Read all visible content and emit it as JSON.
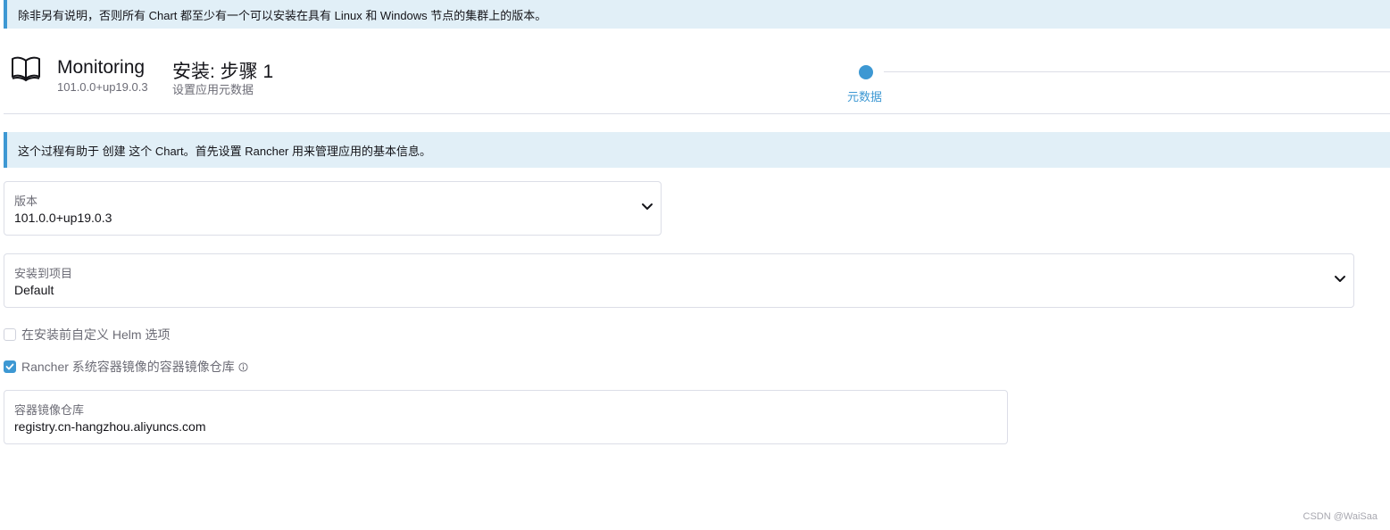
{
  "banners": {
    "top": "除非另有说明，否则所有 Chart 都至少有一个可以安装在具有 Linux 和 Windows 节点的集群上的版本。",
    "mid": "这个过程有助于 创建 这个 Chart。首先设置 Rancher 用来管理应用的基本信息。"
  },
  "header": {
    "app_name": "Monitoring",
    "app_version": "101.0.0+up19.0.3",
    "step_title": "安装: 步骤 1",
    "step_subtitle": "设置应用元数据",
    "step_label": "元数据"
  },
  "form": {
    "version": {
      "label": "版本",
      "value": "101.0.0+up19.0.3"
    },
    "project": {
      "label": "安装到项目",
      "value": "Default"
    },
    "customize_helm": {
      "label": "在安装前自定义 Helm 选项",
      "checked": false
    },
    "system_registry": {
      "label": "Rancher 系统容器镜像的容器镜像仓库",
      "checked": true
    },
    "registry": {
      "label": "容器镜像仓库",
      "value": "registry.cn-hangzhou.aliyuncs.com"
    }
  },
  "watermark": "CSDN @WaiSaa",
  "colors": {
    "accent": "#3d98d3",
    "banner_bg": "#e1eff7",
    "muted_text": "#6c6c76",
    "border": "#dcdee7"
  },
  "icons": [
    "book-icon",
    "chevron-down-icon",
    "checkmark-icon",
    "info-icon"
  ]
}
